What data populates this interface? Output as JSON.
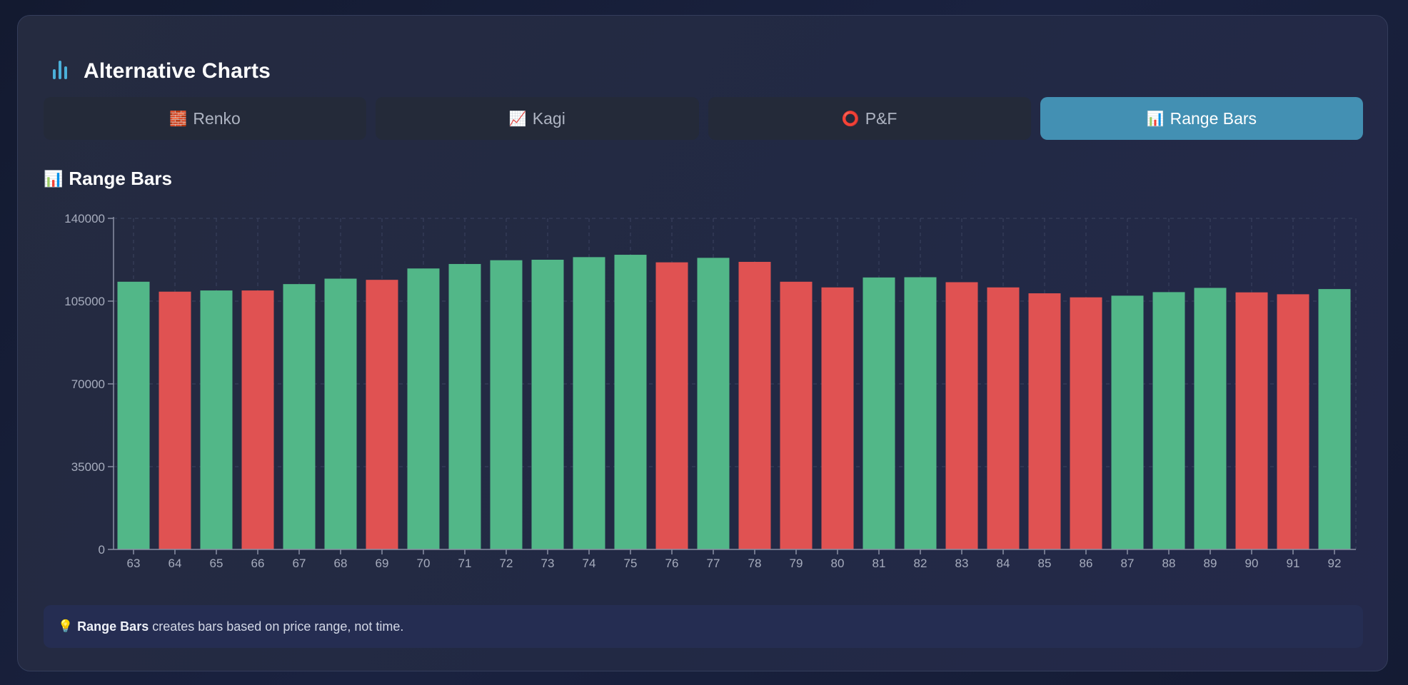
{
  "header": {
    "title": "Alternative Charts",
    "icon": "bar-chart-icon"
  },
  "tabs": [
    {
      "emoji": "🧱",
      "label": "Renko",
      "active": false
    },
    {
      "emoji": "📈",
      "label": "Kagi",
      "active": false
    },
    {
      "emoji": "⭕",
      "label": "P&F",
      "active": false
    },
    {
      "emoji": "📊",
      "label": "Range Bars",
      "active": true
    }
  ],
  "section": {
    "emoji": "📊",
    "title": "Range Bars"
  },
  "colors": {
    "up": "#52b788",
    "down": "#e05252",
    "accent": "#4390b3"
  },
  "chart_data": {
    "type": "bar",
    "title": "",
    "xlabel": "",
    "ylabel": "",
    "ylim": [
      0,
      140000
    ],
    "yticks": [
      0,
      35000,
      70000,
      105000,
      140000
    ],
    "grid": true,
    "categories": [
      "63",
      "64",
      "65",
      "66",
      "67",
      "68",
      "69",
      "70",
      "71",
      "72",
      "73",
      "74",
      "75",
      "76",
      "77",
      "78",
      "79",
      "80",
      "81",
      "82",
      "83",
      "84",
      "85",
      "86",
      "87",
      "88",
      "89",
      "90",
      "91",
      "92"
    ],
    "values": [
      113200,
      109000,
      109500,
      109500,
      112200,
      114500,
      114000,
      118800,
      120700,
      122300,
      122500,
      123600,
      124600,
      121400,
      123300,
      121600,
      113200,
      110800,
      115000,
      115100,
      113000,
      110800,
      108300,
      106600,
      107300,
      108800,
      110600,
      108700,
      107900,
      110100
    ],
    "directions": [
      "up",
      "down",
      "up",
      "down",
      "up",
      "up",
      "down",
      "up",
      "up",
      "up",
      "up",
      "up",
      "up",
      "down",
      "up",
      "down",
      "down",
      "down",
      "up",
      "up",
      "down",
      "down",
      "down",
      "down",
      "up",
      "up",
      "up",
      "down",
      "down",
      "up"
    ]
  },
  "tip": {
    "icon": "💡",
    "bold": "Range Bars",
    "text": "creates bars based on price range, not time."
  }
}
